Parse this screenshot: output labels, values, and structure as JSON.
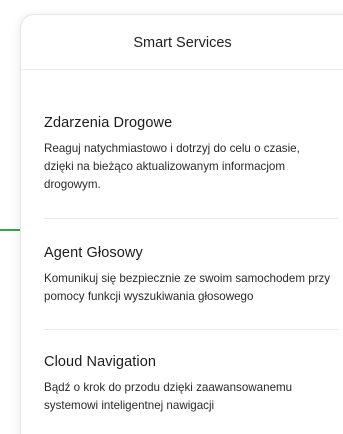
{
  "card": {
    "title": "Smart Services"
  },
  "services": [
    {
      "title": "Zdarzenia Drogowe",
      "description": "Reaguj natychmiastowo i dotrzyj do celu o czasie, dzięki na bieżąco aktualizowanym informacjom drogowym."
    },
    {
      "title": "Agent Głosowy",
      "description": "Komunikuj się bezpiecznie ze swoim samochodem przy pomocy funkcji wyszukiwania głosowego"
    },
    {
      "title": "Cloud Navigation",
      "description": "Bądź o krok do przodu dzięki zaawansowanemu systemowi inteligentnej nawigacji"
    }
  ],
  "colors": {
    "accent_line": "#3aa24a",
    "card_border": "#e6e6e6",
    "text": "#1a1a1a"
  }
}
